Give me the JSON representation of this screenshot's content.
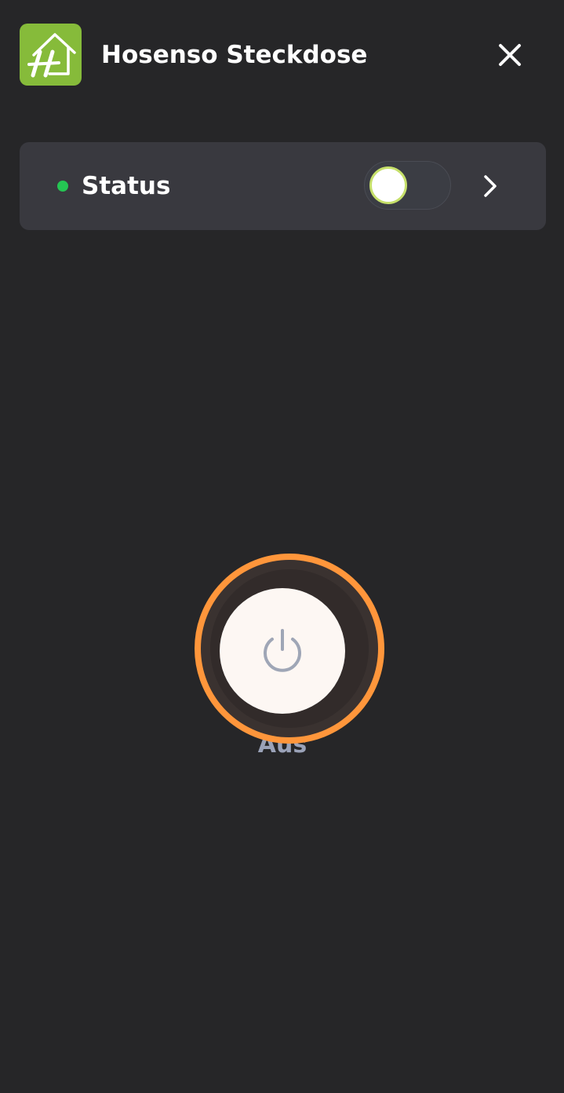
{
  "header": {
    "title": "Hosenso Steckdose",
    "logo_icon": "hosenso-house-logo",
    "close_icon": "close-icon"
  },
  "status_card": {
    "label": "Status",
    "indicator_color": "#25c553",
    "toggle_on": false,
    "chevron_icon": "chevron-right-icon"
  },
  "power": {
    "state_label": "Aus",
    "icon": "power-icon",
    "ring_color": "#ff963b"
  },
  "colors": {
    "background": "#262628",
    "card": "#39393f",
    "logo_green": "#86bb3a"
  }
}
